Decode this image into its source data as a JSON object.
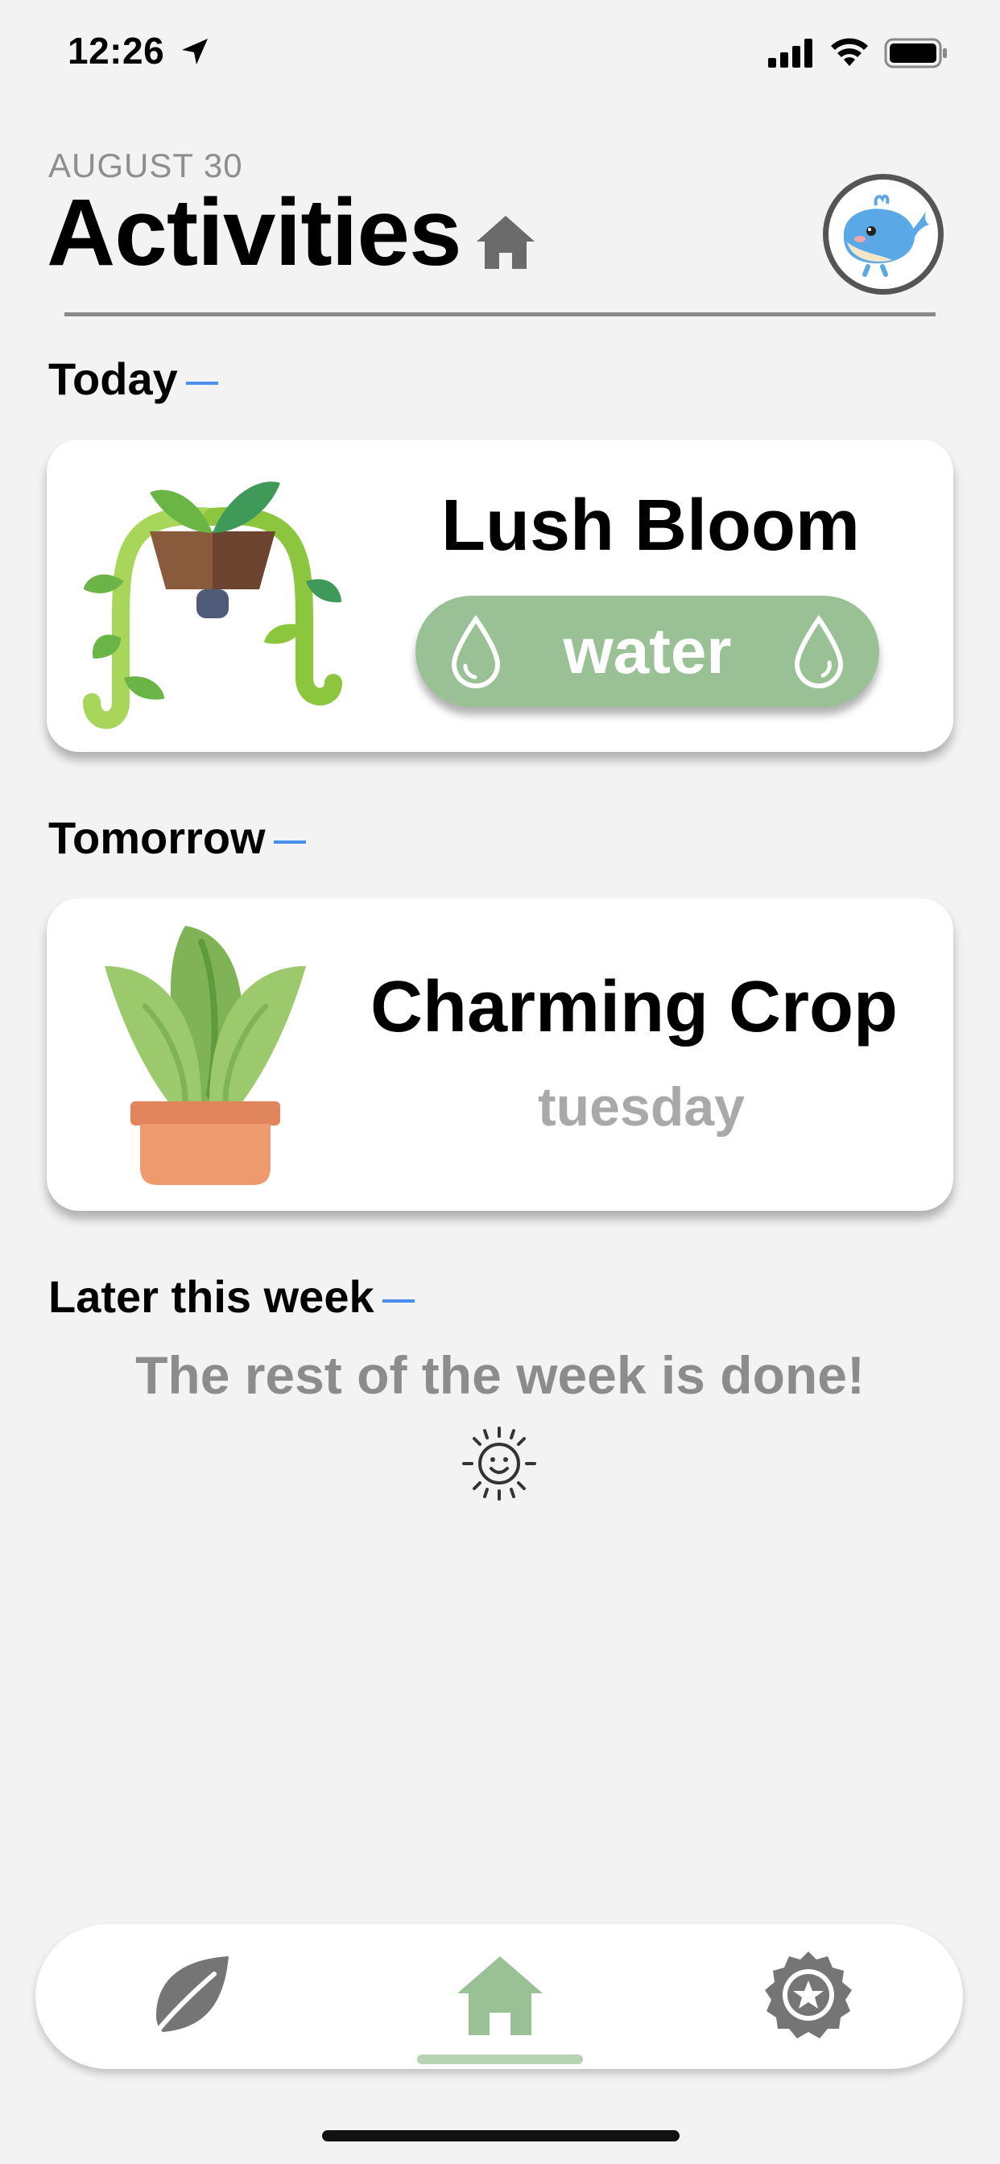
{
  "status_bar": {
    "time": "12:26"
  },
  "header": {
    "date": "AUGUST 30",
    "title": "Activities"
  },
  "sections": {
    "today": "Today",
    "tomorrow": "Tomorrow",
    "later": "Later this week"
  },
  "today_card": {
    "plant_name": "Lush Bloom",
    "action_label": "water"
  },
  "tomorrow_card": {
    "plant_name": "Charming Crop",
    "day": "tuesday"
  },
  "later": {
    "message": "The rest of the week is done!"
  },
  "colors": {
    "accent_green": "#9ac095",
    "section_dash": "#4a8ef0",
    "tab_indicator": "#b6d4b1"
  },
  "icons": {
    "status": [
      "location-arrow-icon",
      "signal-icon",
      "wifi-icon",
      "battery-icon"
    ],
    "header": [
      "home-icon",
      "whale-avatar"
    ],
    "tabs": [
      "leaf-icon",
      "home-icon",
      "badge-star-icon"
    ]
  },
  "tab_bar": {
    "active_tab": "home"
  }
}
